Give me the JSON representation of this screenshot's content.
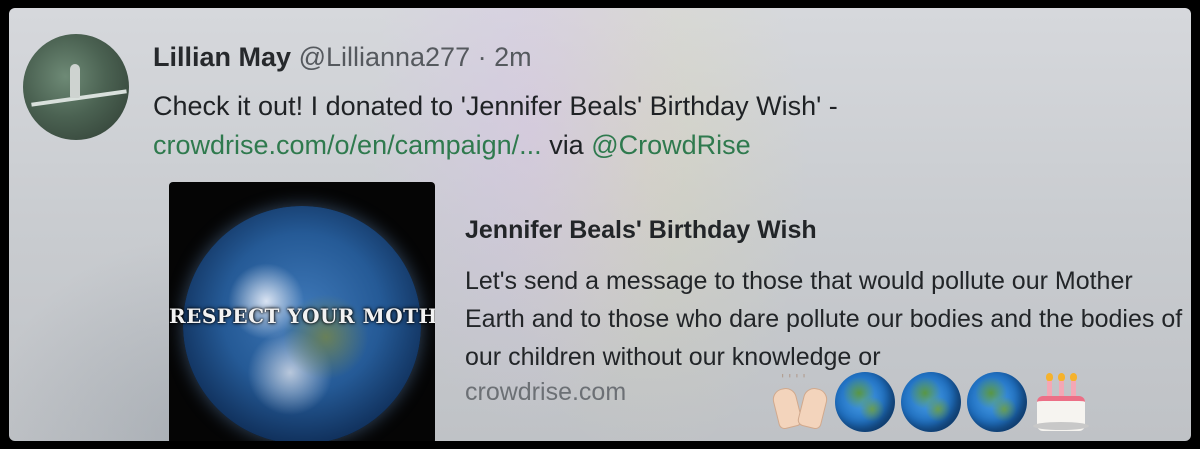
{
  "tweet": {
    "author_name": "Lillian May",
    "handle": "@Lillianna277",
    "separator": "·",
    "timestamp": "2m",
    "text_before": "Check it out! I donated to 'Jennifer Beals' Birthday Wish' -",
    "link_text": "crowdrise.com/o/en/campaign/...",
    "via_text": "via",
    "via_mention": "@CrowdRise"
  },
  "card": {
    "image_caption": "RESPECT YOUR MOTHER",
    "title": "Jennifer Beals' Birthday Wish",
    "description": "Let's send a message to those that would pollute our Mother Earth and to those who dare pollute our bodies and the bodies of our children without our knowledge or",
    "domain": "crowdrise.com"
  },
  "emoji": [
    "raised-hands-icon",
    "globe-americas-icon",
    "globe-americas-icon",
    "globe-americas-icon",
    "birthday-cake-icon"
  ],
  "colors": {
    "link": "#2f7a4e",
    "text": "#1f2225",
    "muted": "#55595e",
    "background": "#d6d8dc"
  }
}
